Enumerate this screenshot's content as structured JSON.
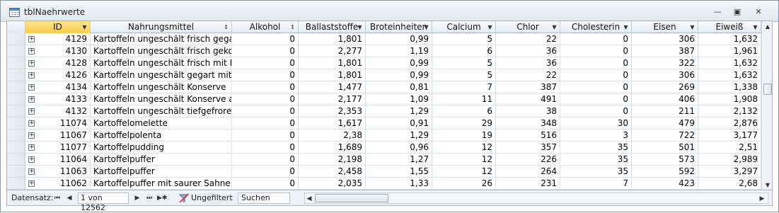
{
  "window": {
    "title": "tblNaehrwerte"
  },
  "columns": [
    {
      "key": "id",
      "label": "ID"
    },
    {
      "key": "nahrungsmittel",
      "label": "Nahrungsmittel"
    },
    {
      "key": "alkohol",
      "label": "Alkohol"
    },
    {
      "key": "ballaststoffe",
      "label": "Ballaststoffe"
    },
    {
      "key": "broteinheiten",
      "label": "Broteinheiten"
    },
    {
      "key": "calcium",
      "label": "Calcium"
    },
    {
      "key": "chlor",
      "label": "Chlor"
    },
    {
      "key": "cholesterin",
      "label": "Cholesterin"
    },
    {
      "key": "eisen",
      "label": "Eisen"
    },
    {
      "key": "eiweiss",
      "label": "Eiweiß"
    }
  ],
  "rows": [
    {
      "id": "4129",
      "nahrungsmittel": "Kartoffeln ungeschält frisch gegart m",
      "alkohol": "0",
      "ballaststoffe": "1,801",
      "broteinheiten": "0,99",
      "calcium": "5",
      "chlor": "22",
      "cholesterin": "0",
      "eisen": "306",
      "eiweiss": "1,632"
    },
    {
      "id": "4130",
      "nahrungsmittel": "Kartoffeln ungeschält frisch gekocht",
      "alkohol": "0",
      "ballaststoffe": "2,277",
      "broteinheiten": "1,19",
      "calcium": "6",
      "chlor": "36",
      "cholesterin": "0",
      "eisen": "387",
      "eiweiss": "1,961"
    },
    {
      "id": "4128",
      "nahrungsmittel": "Kartoffeln ungeschält frisch mit Küch",
      "alkohol": "0",
      "ballaststoffe": "1,801",
      "broteinheiten": "0,99",
      "calcium": "5",
      "chlor": "36",
      "cholesterin": "0",
      "eisen": "322",
      "eiweiss": "1,632"
    },
    {
      "id": "4126",
      "nahrungsmittel": "Kartoffeln ungeschält gegart mit Küc",
      "alkohol": "0",
      "ballaststoffe": "1,801",
      "broteinheiten": "0,99",
      "calcium": "5",
      "chlor": "22",
      "cholesterin": "0",
      "eisen": "306",
      "eiweiss": "1,632"
    },
    {
      "id": "4134",
      "nahrungsmittel": "Kartoffeln ungeschält Konserve",
      "alkohol": "0",
      "ballaststoffe": "1,477",
      "broteinheiten": "0,81",
      "calcium": "7",
      "chlor": "387",
      "cholesterin": "0",
      "eisen": "269",
      "eiweiss": "1,338"
    },
    {
      "id": "4133",
      "nahrungsmittel": "Kartoffeln ungeschält Konserve abge",
      "alkohol": "0",
      "ballaststoffe": "2,177",
      "broteinheiten": "1,09",
      "calcium": "11",
      "chlor": "491",
      "cholesterin": "0",
      "eisen": "406",
      "eiweiss": "1,908"
    },
    {
      "id": "4132",
      "nahrungsmittel": "Kartoffeln ungeschält tiefgefroren",
      "alkohol": "0",
      "ballaststoffe": "2,353",
      "broteinheiten": "1,29",
      "calcium": "6",
      "chlor": "38",
      "cholesterin": "0",
      "eisen": "211",
      "eiweiss": "2,132"
    },
    {
      "id": "11074",
      "nahrungsmittel": "Kartoffelomelette",
      "alkohol": "0",
      "ballaststoffe": "1,617",
      "broteinheiten": "0,91",
      "calcium": "29",
      "chlor": "348",
      "cholesterin": "30",
      "eisen": "479",
      "eiweiss": "2,876"
    },
    {
      "id": "11067",
      "nahrungsmittel": "Kartoffelpolenta",
      "alkohol": "0",
      "ballaststoffe": "2,38",
      "broteinheiten": "1,29",
      "calcium": "19",
      "chlor": "516",
      "cholesterin": "3",
      "eisen": "722",
      "eiweiss": "3,177"
    },
    {
      "id": "11077",
      "nahrungsmittel": "Kartoffelpudding",
      "alkohol": "0",
      "ballaststoffe": "1,689",
      "broteinheiten": "0,96",
      "calcium": "12",
      "chlor": "357",
      "cholesterin": "35",
      "eisen": "501",
      "eiweiss": "2,51"
    },
    {
      "id": "11064",
      "nahrungsmittel": "Kartoffelpuffer",
      "alkohol": "0",
      "ballaststoffe": "2,198",
      "broteinheiten": "1,27",
      "calcium": "12",
      "chlor": "226",
      "cholesterin": "35",
      "eisen": "573",
      "eiweiss": "2,989"
    },
    {
      "id": "11063",
      "nahrungsmittel": "Kartoffelpuffer",
      "alkohol": "0",
      "ballaststoffe": "2,458",
      "broteinheiten": "1,55",
      "calcium": "12",
      "chlor": "264",
      "cholesterin": "35",
      "eisen": "592",
      "eiweiss": "3,297"
    },
    {
      "id": "11062",
      "nahrungsmittel": "Kartoffelpuffer mit saurer Sahne",
      "alkohol": "0",
      "ballaststoffe": "2,035",
      "broteinheiten": "1,33",
      "calcium": "26",
      "chlor": "231",
      "cholesterin": "7",
      "eisen": "423",
      "eiweiss": "2,68"
    }
  ],
  "navigation": {
    "label": "Datensatz:",
    "record_text": "1 von 12562",
    "filter_label": "Ungefiltert",
    "search_value": "Suchen"
  },
  "icons": {
    "table": "table-icon",
    "minimize": "minimize-icon",
    "restore": "restore-icon",
    "close": "close-icon",
    "expand": "plus-expand-icon",
    "dropdown": "dropdown-arrow-icon",
    "sort_asc": "sort-ascending-icon",
    "filter": "filter-off-icon"
  },
  "colors": {
    "id_header": "#f8cc4e",
    "window_border": "#8a94a3",
    "grid_lines": "#dbe1e9"
  }
}
